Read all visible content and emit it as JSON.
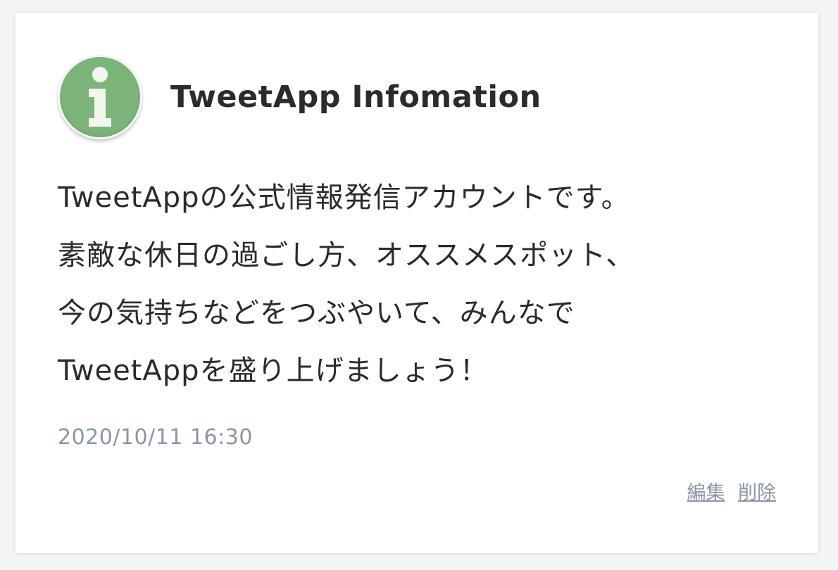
{
  "post": {
    "user": {
      "name": "TweetApp Infomation",
      "avatar_icon": "info-icon",
      "avatar_color": "#7db47a"
    },
    "content_lines": [
      "TweetAppの公式情報発信アカウントです。",
      "素敵な休日の過ごし方、オススメスポット、",
      "今の気持ちなどをつぶやいて、みんなで",
      "TweetAppを盛り上げましょう！"
    ],
    "created_at": "2020/10/11 16:30",
    "menus": {
      "edit_label": "編集",
      "delete_label": "削除"
    }
  }
}
